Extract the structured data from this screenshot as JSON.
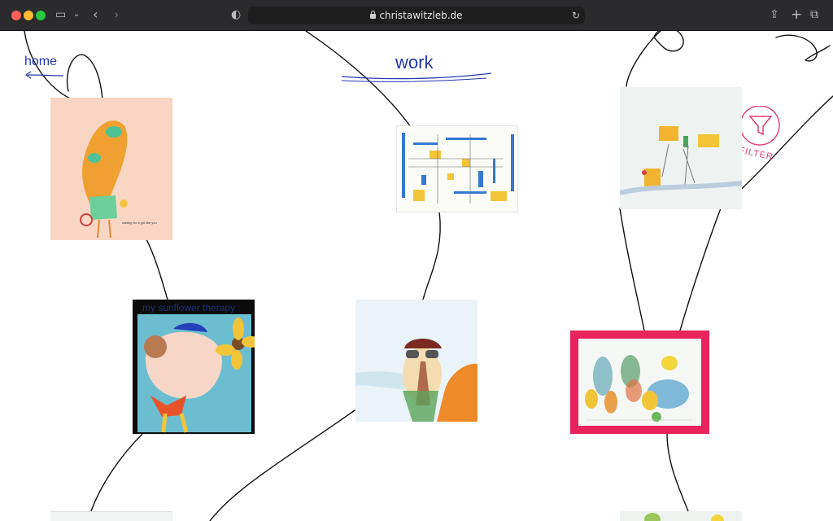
{
  "browser": {
    "url": "christawitzleb.de"
  },
  "nav": {
    "home": "home",
    "work": "work",
    "filter": "FILTER"
  },
  "artworks": [
    {
      "caption": "waiting for a girl like you"
    },
    {
      "caption": ""
    },
    {
      "caption": ""
    },
    {
      "caption": "my sunflower therapy"
    },
    {
      "caption": ""
    },
    {
      "caption": ""
    }
  ],
  "colors": {
    "nav_blue": "#2536b0",
    "filter_pink": "#e23d6e",
    "highlight_frame": "#e8235d"
  }
}
